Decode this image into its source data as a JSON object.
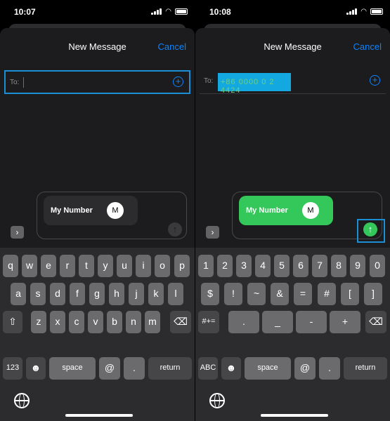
{
  "left": {
    "time": "10:07",
    "title": "New Message",
    "cancel": "Cancel",
    "to_label": "To:",
    "bubble_label": "My Number",
    "avatar_initial": "M",
    "send_icon": "↑",
    "expand_icon": "›",
    "keys": {
      "row1": [
        "q",
        "w",
        "e",
        "r",
        "t",
        "y",
        "u",
        "i",
        "o",
        "p"
      ],
      "row2": [
        "a",
        "s",
        "d",
        "f",
        "g",
        "h",
        "j",
        "k",
        "l"
      ],
      "row3": [
        "z",
        "x",
        "c",
        "v",
        "b",
        "n",
        "m"
      ],
      "shift": "⇧",
      "backspace": "⌫",
      "mode": "123",
      "emoji": "☻",
      "space": "space",
      "at": "@",
      "dot": ".",
      "return": "return"
    }
  },
  "right": {
    "time": "10:08",
    "title": "New Message",
    "cancel": "Cancel",
    "to_label": "To:",
    "recipient": "+86 0000 0 2 4424",
    "bubble_label": "My Number",
    "avatar_initial": "M",
    "send_icon": "↑",
    "expand_icon": "›",
    "keys": {
      "row1": [
        "1",
        "2",
        "3",
        "4",
        "5",
        "6",
        "7",
        "8",
        "9",
        "0"
      ],
      "row2": [
        "$",
        "!",
        "~",
        "&",
        "=",
        "#",
        "[",
        "]"
      ],
      "row3": [
        ".",
        "_",
        "-",
        "+"
      ],
      "mode_shift": "#+=",
      "backspace": "⌫",
      "mode": "ABC",
      "emoji": "☻",
      "space": "space",
      "at": "@",
      "dot": ".",
      "return": "return"
    }
  },
  "colors": {
    "accent": "#0a84ff",
    "send_green": "#34c759",
    "highlight": "#1a8fd6"
  }
}
